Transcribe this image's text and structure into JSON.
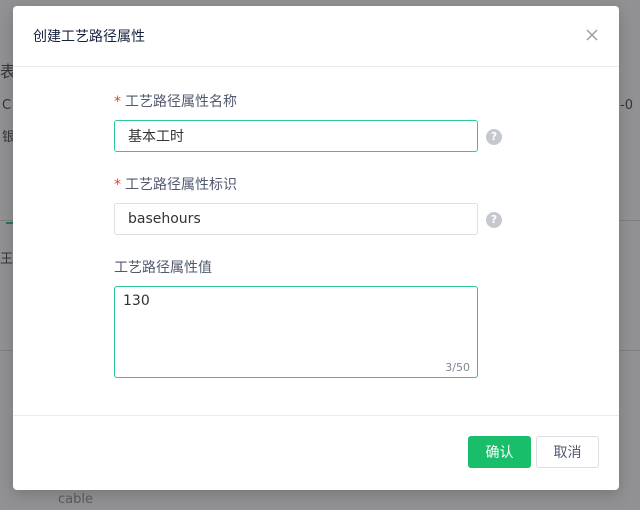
{
  "background": {
    "fragment_left_1": "表",
    "fragment_left_2": "C",
    "fragment_left_3": "银",
    "fragment_left_4": "王",
    "fragment_right_1": "-0",
    "fragment_bottom": "cable"
  },
  "dialog": {
    "title": "创建工艺路径属性",
    "close_glyph": "×",
    "required_mark": "*",
    "help_glyph": "?",
    "fields": {
      "name": {
        "label": "工艺路径属性名称",
        "value": "基本工时",
        "required": true
      },
      "identifier": {
        "label": "工艺路径属性标识",
        "value": "basehours",
        "required": true
      },
      "value": {
        "label": "工艺路径属性值",
        "value": "130",
        "word_count": "3/50",
        "required": false
      }
    },
    "footer": {
      "confirm_label": "确认",
      "cancel_label": "取消"
    }
  },
  "colors": {
    "primary": "#19be6b",
    "focus_border": "#2fc797",
    "required": "#ed4014"
  }
}
